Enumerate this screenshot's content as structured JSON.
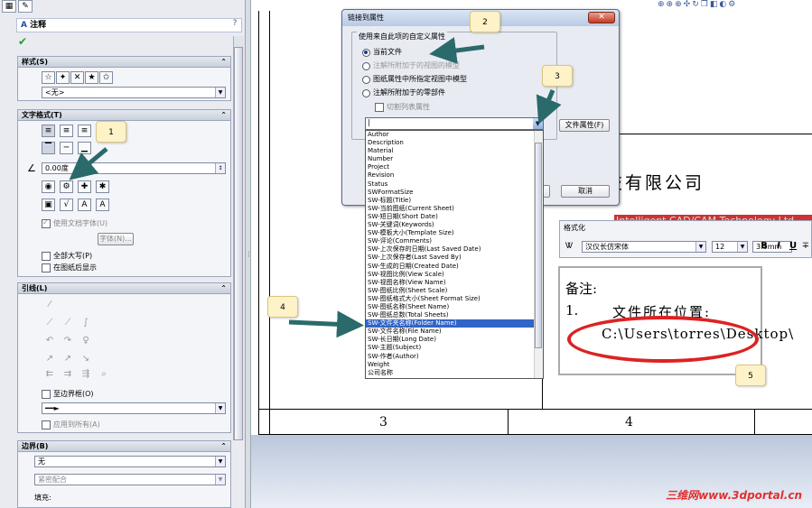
{
  "left_panel": {
    "tab_icons": [
      "feature-manager-icon",
      "property-manager-icon"
    ],
    "title": "注释",
    "help": "?",
    "styles": {
      "header": "样式(S)",
      "dropdown_value": "<无>"
    },
    "text_format": {
      "header": "文字格式(T)",
      "angle_value": "0.00度",
      "use_doc_font": "使用文档字体(U)",
      "font_button": "字体(N)...",
      "all_caps": "全部大写(P)",
      "show_on_sheet": "在图纸后显示"
    },
    "leader": {
      "header": "引线(L)",
      "to_border": "至边界框(O)",
      "apply_all": "应用到所有(A)"
    },
    "border": {
      "header": "边界(B)",
      "style_value": "无",
      "fit_value": "紧密配合",
      "fill_label": "填充:"
    }
  },
  "dialog": {
    "title": "链接到属性",
    "group_label": "使用来自此项的自定义属性",
    "radios": [
      {
        "label": "当前文件",
        "selected": true,
        "disabled": false
      },
      {
        "label": "注解所附加于的视图的模型",
        "selected": false,
        "disabled": true
      },
      {
        "label": "图纸属性中所指定视图中模型",
        "selected": false,
        "disabled": false
      },
      {
        "label": "注解所附加于的零部件",
        "selected": false,
        "disabled": false
      }
    ],
    "sub_checkbox": "切割列表属性",
    "combo_value": "|",
    "file_props_button": "文件属性(F)",
    "cancel_button": "取消",
    "list_items": [
      "Author",
      "Description",
      "Material",
      "Number",
      "Project",
      "Revision",
      "Status",
      "SWFormatSize",
      "SW-标题(Title)",
      "SW-当前图纸(Current Sheet)",
      "SW-短日期(Short Date)",
      "SW-关键词(Keywords)",
      "SW-模板大小(Template Size)",
      "SW-评论(Comments)",
      "SW-上次保存的日期(Last Saved Date)",
      "SW-上次保存者(Last Saved By)",
      "SW-生成的日期(Created Date)",
      "SW-视图比例(View Scale)",
      "SW-视图名称(View Name)",
      "SW-图纸比例(Sheet Scale)",
      "SW-图纸格式大小(Sheet Format Size)",
      "SW-图纸名称(Sheet Name)",
      "SW-图纸总数(Total Sheets)",
      "SW-文件夹名称(Folder Name)",
      "SW-文件名称(File Name)",
      "SW-长日期(Long Date)",
      "SW-主题(Subject)",
      "SW-作者(Author)",
      "Weight",
      "公司名称"
    ],
    "selected_index": 23
  },
  "drawing": {
    "company": "誠科技有限公司",
    "slogan": "Intelligent CAD/CAM Technology Ltd",
    "format_toolbar": {
      "title": "格式化",
      "font": "汉仪长仿宋体",
      "size": "12",
      "height": "3.5mm",
      "bold": "B",
      "italic": "I",
      "underline": "U"
    },
    "note": {
      "title": "备注:",
      "line1_num": "1.",
      "line1_text": "文件所在位置:",
      "path": "C:\\Users\\torres\\Desktop\\"
    },
    "zone_labels": [
      "3",
      "4"
    ],
    "watermark": "三维网www.3dportal.cn"
  },
  "callouts": [
    "1",
    "2",
    "3",
    "4",
    "5"
  ],
  "colors": {
    "callout_bg": "#fdf2c8",
    "arrow": "#2a6a6a",
    "ellipse": "#dd2222",
    "selection": "#3264c8"
  }
}
